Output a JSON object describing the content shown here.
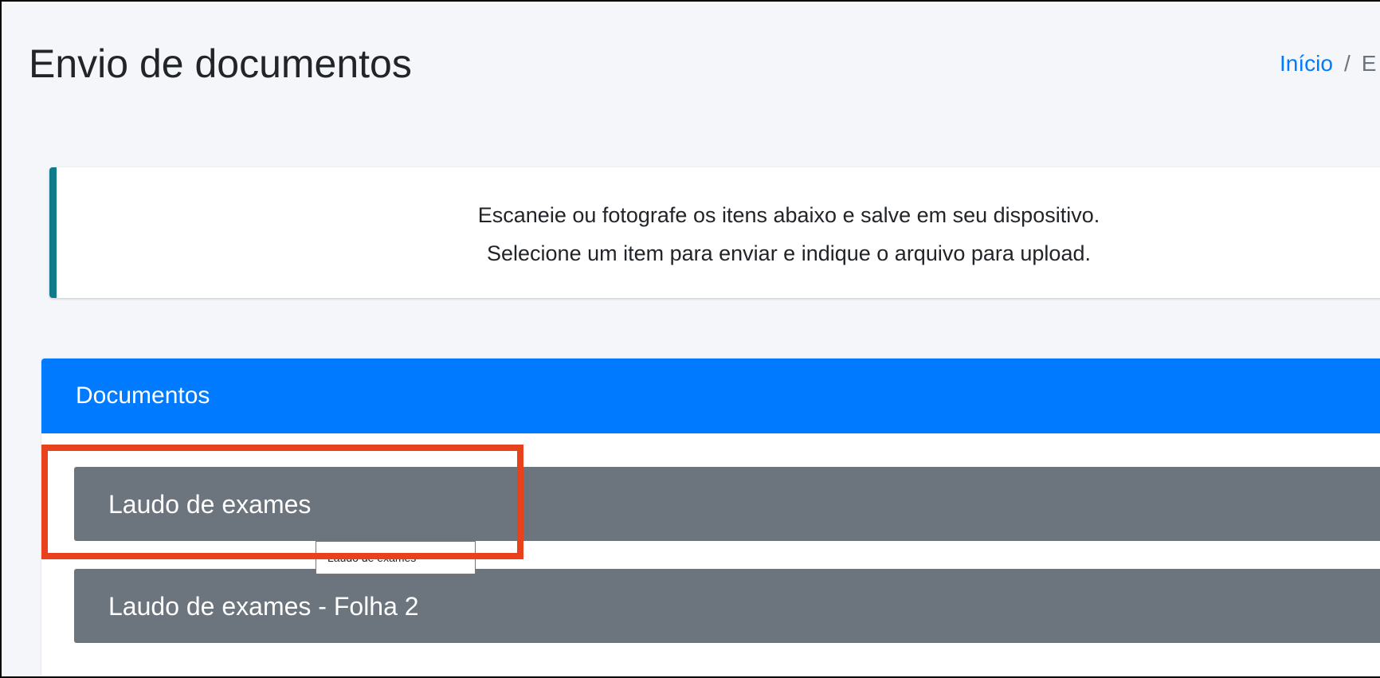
{
  "page": {
    "title": "Envio de documentos"
  },
  "breadcrumb": {
    "home": "Início",
    "separator": "/",
    "current": "E"
  },
  "callout": {
    "line1": "Escaneie ou fotografe os itens abaixo e salve em seu dispositivo.",
    "line2": "Selecione um item para enviar e indique o arquivo para upload."
  },
  "documents_card": {
    "title": "Documentos",
    "items": [
      {
        "label": "Laudo de exames"
      },
      {
        "label": "Laudo de exames - Folha 2"
      }
    ]
  },
  "tooltip": {
    "text": "Laudo de exames"
  },
  "colors": {
    "primary": "#007bff",
    "callout_border": "#117a8b",
    "item_bg": "#6c757d",
    "highlight": "#e8411b",
    "page_bg": "#f4f6f9"
  }
}
